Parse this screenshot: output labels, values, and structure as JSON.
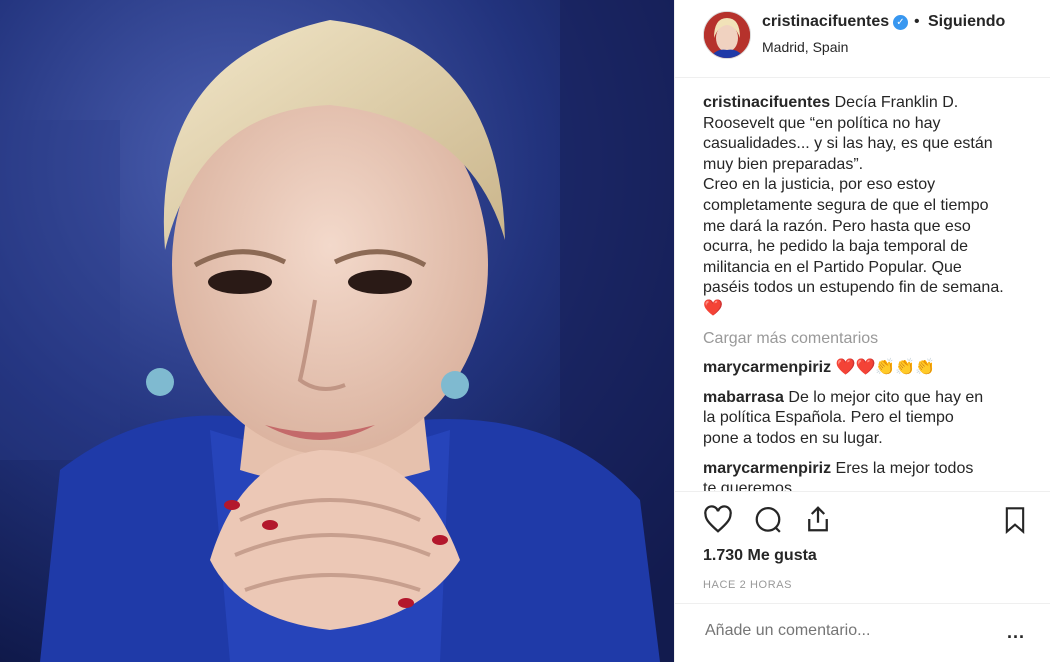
{
  "header": {
    "username": "cristinacifuentes",
    "verified_glyph": "✓",
    "separator": "•",
    "follow_label": "Siguiendo",
    "location": "Madrid, Spain"
  },
  "caption": {
    "username": "cristinacifuentes",
    "text": "Decía Franklin D. Roosevelt que “en política no hay casualidades... y si las hay, es que están muy bien preparadas”.\nCreo en la justicia, por eso estoy completamente segura de que el tiempo me dará la razón. Pero hasta que eso ocurra, he pedido la baja temporal de militancia en el Partido Popular. Que paséis todos un estupendo fin de semana.❤️"
  },
  "load_more_label": "Cargar más comentarios",
  "comments": [
    {
      "username": "marycarmenpiriz",
      "text": "❤️❤️👏👏👏"
    },
    {
      "username": "mabarrasa",
      "text": "De lo mejor cito que hay en la política Española. Pero el tiempo pone a todos en su lugar."
    },
    {
      "username": "marycarmenpiriz",
      "text": "Eres la mejor todos te queremos"
    }
  ],
  "actions": {
    "icons": [
      "heart-icon",
      "comment-icon",
      "share-icon",
      "bookmark-icon"
    ],
    "likes": "1.730 Me gusta",
    "time": "HACE 2 HORAS"
  },
  "add_comment": {
    "placeholder": "Añade un comentario...",
    "more_label": "..."
  },
  "colors": {
    "text": "#262626",
    "muted": "#999999",
    "verified": "#3897f0",
    "border": "#efefef"
  }
}
